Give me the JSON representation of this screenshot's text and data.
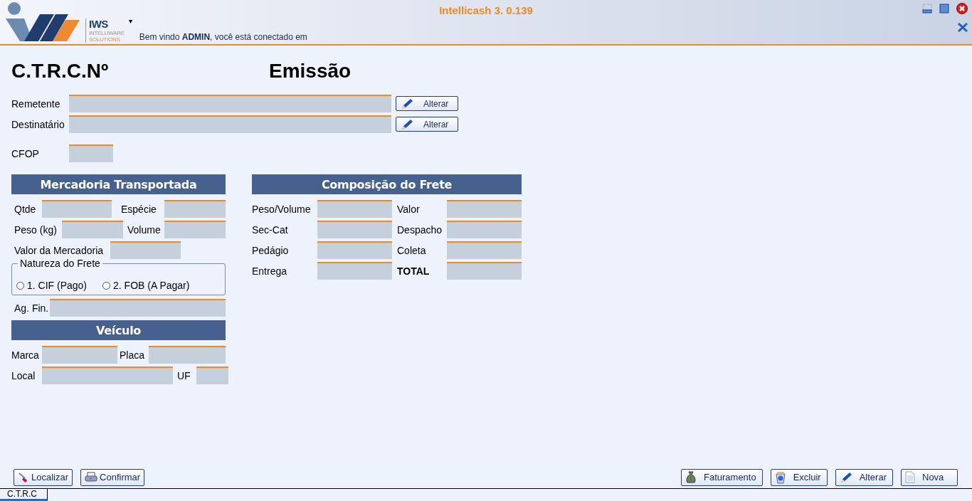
{
  "header": {
    "logo": {
      "brand": "IWS",
      "line1": "INTELLIWARE",
      "line2": "SOLUTIONS"
    },
    "dropdown_caret": "▾",
    "app_title": "Intellicash 3. 0.139",
    "welcome": "Bem vindo **ADMIN**, você está conectado em"
  },
  "heading": {
    "number_label": "C.T.R.C.Nº",
    "status": "Emissão"
  },
  "parties": [
    {
      "label": "Remetente",
      "button": "Alterar"
    },
    {
      "label": "Destinatário",
      "button": "Alterar"
    }
  ],
  "cfop": {
    "label": "CFOP"
  },
  "cargo": {
    "title": "Mercadoria Transportada",
    "qtde": "Qtde",
    "especie": "Espécie",
    "peso": "Peso (kg)",
    "volume": "Volume",
    "valor": "Valor da Mercadoria",
    "freight_nature": {
      "legend": "Natureza do Frete",
      "options": [
        {
          "label": "1. CIF (Pago)",
          "selected": false
        },
        {
          "label": "2. FOB (A Pagar)",
          "selected": false
        }
      ]
    },
    "ag_fin": "Ag. Fin."
  },
  "vehicle": {
    "title": "Veículo",
    "marca": "Marca",
    "placa": "Placa",
    "local": "Local",
    "uf": "UF"
  },
  "freight": {
    "title": "Composição do Frete",
    "rows": [
      {
        "left": "Peso/Volume",
        "right": "Valor"
      },
      {
        "left": "Sec-Cat",
        "right": "Despacho"
      },
      {
        "left": "Pedágio",
        "right": "Coleta"
      },
      {
        "left": "Entrega",
        "right": "TOTAL"
      }
    ]
  },
  "left_buttons": [
    {
      "kind": "search",
      "label": "Localizar"
    },
    {
      "kind": "print",
      "label": "Confirmar"
    }
  ],
  "right_buttons": [
    {
      "kind": "money",
      "label": "Faturamento"
    },
    {
      "kind": "trash",
      "label": "Excluir"
    },
    {
      "kind": "pencil",
      "label": "Alterar"
    },
    {
      "kind": "page",
      "label": "Nova"
    }
  ],
  "tabs": [
    {
      "label": "C.T.R.C",
      "selected": true
    }
  ]
}
